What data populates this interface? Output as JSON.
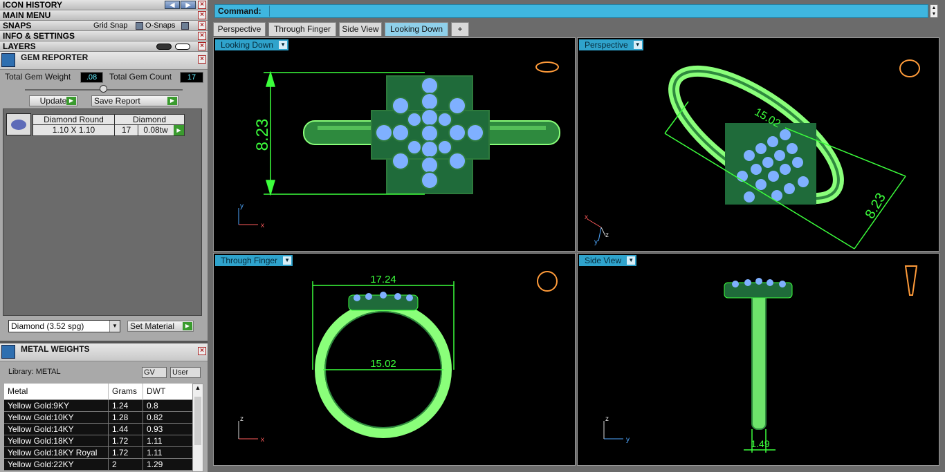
{
  "left_panel": {
    "icon_history": "ICON HISTORY",
    "main_menu": "MAIN MENU",
    "snaps": "SNAPS",
    "grid_snap": "Grid Snap",
    "o_snaps": "O-Snaps",
    "info_settings": "INFO & SETTINGS",
    "layers": "LAYERS"
  },
  "gem_reporter": {
    "title": "GEM REPORTER",
    "total_weight_label": "Total Gem Weight",
    "total_weight_value": ".08",
    "total_count_label": "Total Gem Count",
    "total_count_value": "17",
    "update": "Update",
    "save_report": "Save Report",
    "gem_name": "Diamond Round",
    "gem_material": "Diamond",
    "gem_size": "1.10 X 1.10",
    "gem_count": "17",
    "gem_tw": "0.08tw",
    "material_select": "Diamond    (3.52 spg)",
    "set_material": "Set Material"
  },
  "metal_weights": {
    "title": "METAL WEIGHTS",
    "library": "Library: METAL",
    "gv": "GV",
    "user": "User",
    "columns": [
      "Metal",
      "Grams",
      "DWT"
    ],
    "rows": [
      [
        "Yellow Gold:9KY",
        "1.24",
        "0.8"
      ],
      [
        "Yellow Gold:10KY",
        "1.28",
        "0.82"
      ],
      [
        "Yellow Gold:14KY",
        "1.44",
        "0.93"
      ],
      [
        "Yellow Gold:18KY",
        "1.72",
        "1.11"
      ],
      [
        "Yellow Gold:18KY Royal",
        "1.72",
        "1.11"
      ],
      [
        "Yellow Gold:22KY",
        "2",
        "1.29"
      ]
    ]
  },
  "command": {
    "label": "Command:"
  },
  "tabs": [
    "Perspective",
    "Through Finger",
    "Side View",
    "Looking Down"
  ],
  "active_tab": "Looking Down",
  "viewports": {
    "top_left": {
      "label": "Looking Down",
      "dim1": "8.23"
    },
    "top_right": {
      "label": "Perspective",
      "dim1": "15.02",
      "dim2": "8.23"
    },
    "bottom_left": {
      "label": "Through Finger",
      "dim1": "17.24",
      "dim2": "15.02"
    },
    "bottom_right": {
      "label": "Side View",
      "dim1": "1.49"
    }
  },
  "axes": {
    "x": "x",
    "y": "y",
    "z": "z"
  },
  "colors": {
    "ring": "#7dff6e",
    "gem": "#7fb0ff",
    "cyan": "#3fb6df"
  },
  "icons": [
    "arrow-left-icon",
    "arrow-right-icon",
    "close-icon",
    "eye-icon",
    "gem-icon",
    "metal-icon",
    "dropdown-icon",
    "play-icon",
    "plus-icon"
  ]
}
